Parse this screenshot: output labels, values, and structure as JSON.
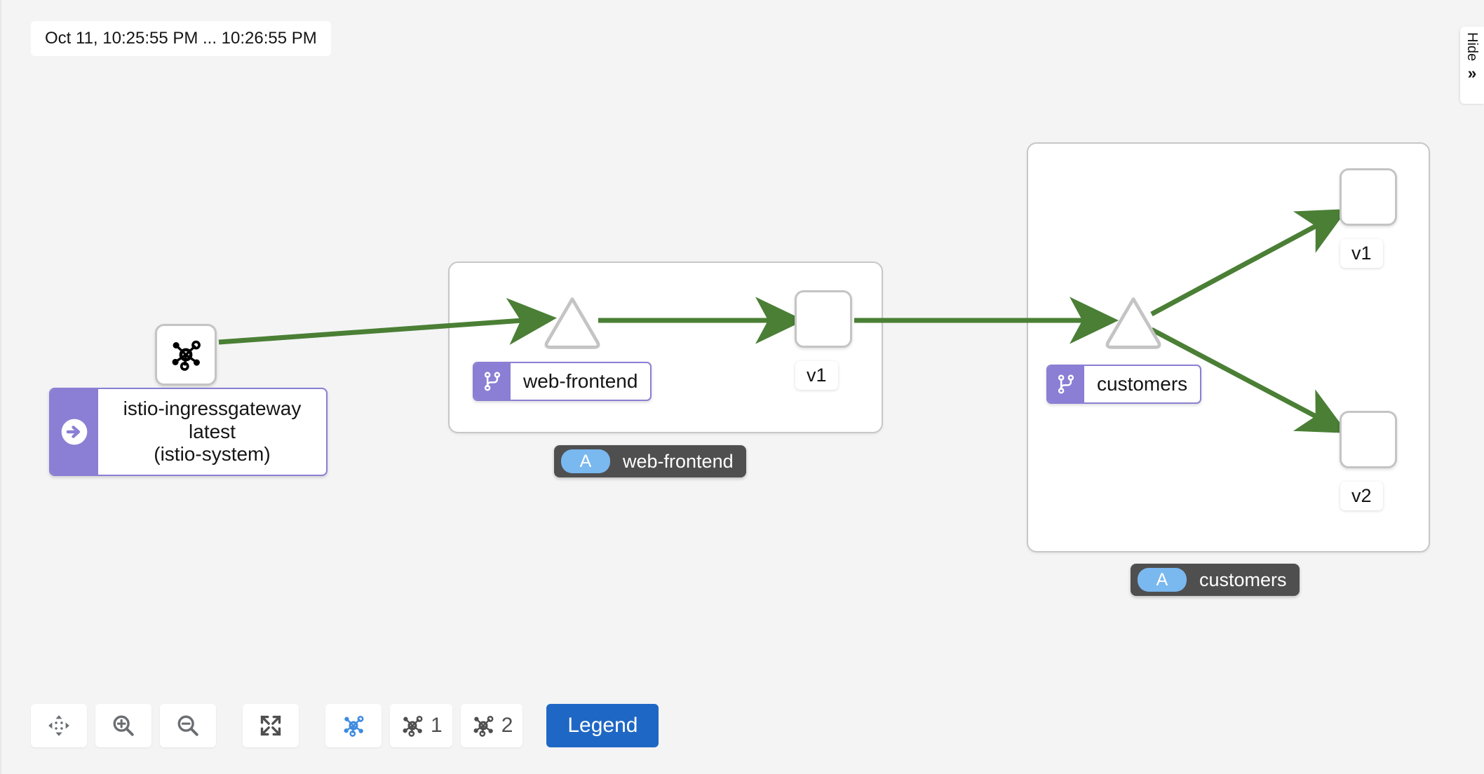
{
  "time_range": {
    "label": "Oct 11, 10:25:55 PM ... 10:26:55 PM"
  },
  "drawer": {
    "hide_label": "Hide",
    "chevron": "»"
  },
  "graph": {
    "gateway": {
      "icon": "topology-icon",
      "badge_icon": "arrow-right-circle-icon",
      "name": "istio-ingressgateway",
      "version": "latest",
      "namespace": "(istio-system)"
    },
    "groups": [
      {
        "id": "web-frontend",
        "badge_icon": "code-branch-icon",
        "badge_label": "web-frontend",
        "tooltip_pill": "A",
        "tooltip_label": "web-frontend",
        "versions": [
          "v1"
        ]
      },
      {
        "id": "customers",
        "badge_icon": "code-branch-icon",
        "badge_label": "customers",
        "tooltip_pill": "A",
        "tooltip_label": "customers",
        "versions": [
          "v1",
          "v2"
        ]
      }
    ],
    "version_labels": {
      "web_frontend_v1": "v1",
      "customers_v1": "v1",
      "customers_v2": "v2"
    },
    "edge_color": "#4a7f35"
  },
  "toolbar": {
    "buttons": [
      {
        "name": "drag-toggle",
        "icon": "arrows-move-icon",
        "label": ""
      },
      {
        "name": "zoom-in",
        "icon": "zoom-in-icon",
        "label": ""
      },
      {
        "name": "zoom-out",
        "icon": "zoom-out-icon",
        "label": ""
      },
      {
        "name": "fit-to-screen",
        "icon": "expand-icon",
        "label": ""
      },
      {
        "name": "layout-default",
        "icon": "topology-icon",
        "label": ""
      },
      {
        "name": "layout-1",
        "icon": "topology-icon",
        "label": "1"
      },
      {
        "name": "layout-2",
        "icon": "topology-icon",
        "label": "2"
      }
    ],
    "legend_label": "Legend",
    "active_layout_color": "#3d8ae0",
    "legend_color": "#1f67c4"
  }
}
